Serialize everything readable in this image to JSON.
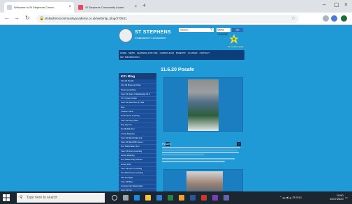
{
  "browser": {
    "tabs": [
      {
        "label": "Welcome to St Stephens Comm",
        "active": true,
        "favicon_color": "#c9d3e0"
      },
      {
        "label": "St Stephens Community Acade",
        "active": false,
        "favicon_color": "#e8495c"
      }
    ],
    "url": "ststephenscommunityacademy.co.uk/web/nlp_blog/370531",
    "window_controls": {
      "minimize": "–",
      "maximize": "▢",
      "close": "×"
    },
    "new_tab": "+"
  },
  "site": {
    "name": "ST STEPHENS",
    "subtitle": "COMMUNITY ACADEMY",
    "search_placeholder": "Search...",
    "select_value": "Select Language",
    "go_label": "Go",
    "partner_logo_text": "the Golden Apple",
    "nav_row1": [
      "HOME",
      "NEWS",
      "LEARNING FOR LIFE",
      "CURRICULUM",
      "PARENTS",
      "CLASSES",
      "CONTACT"
    ],
    "nav_row2": [
      "KEY INFORMATION"
    ]
  },
  "sidebar": {
    "title": "KS1 Blog",
    "items": [
      "11.6.20 Posafe",
      "11.6.20 Bump and bike",
      "Tweet something",
      "Year 1/2 class 1 Wednesday 10.6",
      "17.6 Tyreic Fimbur",
      "Year 1/2 class Mon 8.6 Eid",
      "blog",
      "Chicken Plans",
      "Tenth Home Learning",
      "Year 1/2 Ferry ticket",
      "Dog day Fun",
      "Our Bubble Fun",
      "Lovely Mapping",
      "Year 1/2 Wed Friday Fun",
      "Year 1/2 Wed 25th Home",
      "Our Teddy Bears Fun",
      "Year 1/2 Home Learning",
      "Lovely Mapping",
      "Our Wishes Day and Eid",
      "Lovely Pets",
      "Year 1/2 Home Learning",
      "Our Sixth Home Learning",
      "This Fortnight",
      "Year 1/2 Blog",
      "Jumping into Wednesday",
      "Year 1/2 Fun",
      "Our History Questions",
      "Year 1/2 Class News",
      "Learning in the Park",
      "Our Week Fun"
    ]
  },
  "post": {
    "title": "11.6.20 Posafe",
    "section_label": "Posafe",
    "prev": "‹",
    "next": "›"
  },
  "taskbar": {
    "search_placeholder": "Type here to search",
    "time": "15:50",
    "date": "11/07/2020"
  },
  "colors": {
    "site_bg": "#1f9ad6",
    "nav_bg": "#0c3e7a",
    "sidebar_bg": "#1c4f99"
  }
}
